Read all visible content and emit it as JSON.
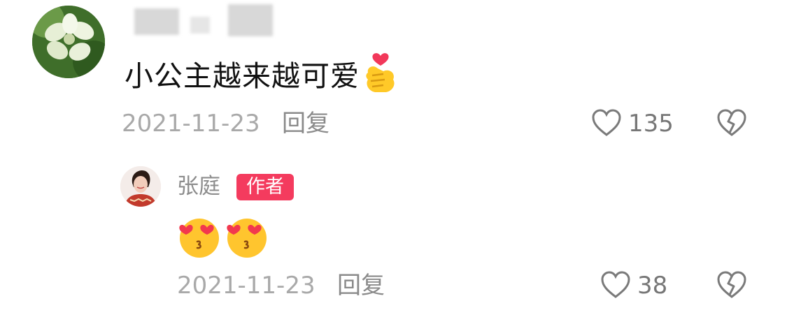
{
  "comments": [
    {
      "text": "小公主越来越可爱",
      "emoji": "finger-heart-emoji",
      "date": "2021-11-23",
      "reply_label": "回复",
      "likes": "135"
    }
  ],
  "reply": {
    "author_name": "张庭",
    "badge": "作者",
    "emojis": [
      "heart-eyes-kiss-emoji",
      "heart-eyes-kiss-emoji"
    ],
    "date": "2021-11-23",
    "reply_label": "回复",
    "likes": "38"
  },
  "colors": {
    "badge_bg": "#f43b5e",
    "meta_text": "#a9a9a9",
    "icon_stroke": "#7a7a7a"
  }
}
